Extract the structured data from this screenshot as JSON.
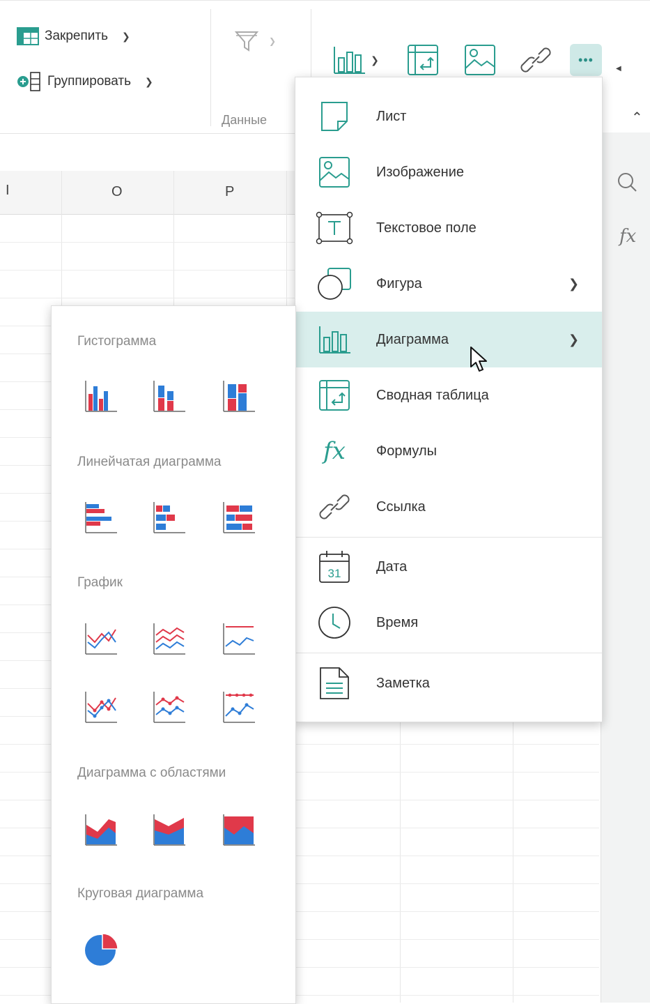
{
  "ribbon": {
    "freeze_label": "Закрепить",
    "group_label": "Группировать",
    "data_group_label": "Данные"
  },
  "sheet": {
    "columns": [
      "I",
      "O",
      "P"
    ]
  },
  "insert_menu": {
    "items": [
      {
        "label": "Лист",
        "icon": "sheet-icon"
      },
      {
        "label": "Изображение",
        "icon": "image-icon"
      },
      {
        "label": "Текстовое поле",
        "icon": "text-box-icon"
      },
      {
        "label": "Фигура",
        "icon": "shape-icon",
        "submenu": true
      },
      {
        "label": "Диаграмма",
        "icon": "chart-icon",
        "submenu": true,
        "highlighted": true
      },
      {
        "label": "Сводная таблица",
        "icon": "pivot-table-icon"
      },
      {
        "label": "Формулы",
        "icon": "formula-icon"
      },
      {
        "label": "Ссылка",
        "icon": "link-icon"
      },
      {
        "label": "Дата",
        "icon": "calendar-icon",
        "calendar_day": "31"
      },
      {
        "label": "Время",
        "icon": "clock-icon"
      },
      {
        "label": "Заметка",
        "icon": "note-icon"
      }
    ]
  },
  "chart_menu": {
    "sections": [
      {
        "title": "Гистограмма",
        "types": [
          "clustered-column",
          "stacked-column",
          "100-stacked-column"
        ]
      },
      {
        "title": "Линейчатая диаграмма",
        "types": [
          "clustered-bar",
          "stacked-bar",
          "100-stacked-bar"
        ]
      },
      {
        "title": "График",
        "types": [
          "line",
          "stacked-line",
          "100-stacked-line",
          "line-markers",
          "stacked-line-markers",
          "100-stacked-line-markers"
        ]
      },
      {
        "title": "Диаграмма с областями",
        "types": [
          "area",
          "stacked-area",
          "100-stacked-area"
        ]
      },
      {
        "title": "Круговая диаграмма",
        "types": [
          "pie"
        ]
      }
    ]
  },
  "colors": {
    "accent": "#2a9d8f",
    "highlight": "#d9eeec",
    "chart_blue": "#2e7dd7",
    "chart_red": "#e0394a"
  }
}
